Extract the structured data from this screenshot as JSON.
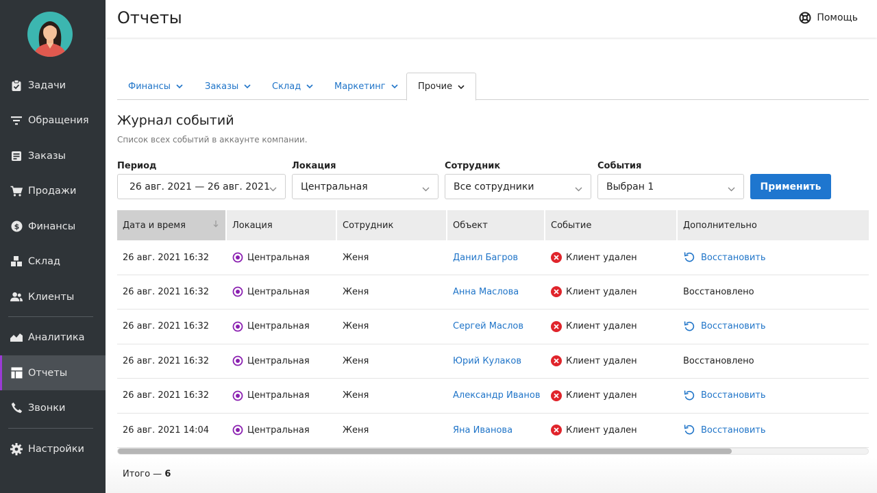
{
  "sidebar": {
    "items": [
      {
        "label": "Задачи",
        "icon": "clipboard-icon"
      },
      {
        "label": "Обращения",
        "icon": "filter-icon"
      },
      {
        "label": "Заказы",
        "icon": "order-icon"
      },
      {
        "label": "Продажи",
        "icon": "cart-icon"
      },
      {
        "label": "Финансы",
        "icon": "dollar-icon"
      },
      {
        "label": "Склад",
        "icon": "boxes-icon"
      },
      {
        "label": "Клиенты",
        "icon": "users-icon"
      },
      {
        "label": "Аналитика",
        "icon": "chart-icon"
      },
      {
        "label": "Отчеты",
        "icon": "table-icon"
      },
      {
        "label": "Звонки",
        "icon": "phone-icon"
      },
      {
        "label": "Настройки",
        "icon": "gear-icon"
      }
    ],
    "active": "Отчеты"
  },
  "header": {
    "title": "Отчеты",
    "help_label": "Помощь"
  },
  "tabs": [
    {
      "label": "Финансы"
    },
    {
      "label": "Заказы"
    },
    {
      "label": "Склад"
    },
    {
      "label": "Маркетинг"
    },
    {
      "label": "Прочие"
    }
  ],
  "section": {
    "title": "Журнал событий",
    "subtitle": "Список всех событий в аккаунте компании."
  },
  "filters": {
    "period": {
      "label": "Период",
      "value": "26 авг. 2021 — 26 авг. 2021"
    },
    "location": {
      "label": "Локация",
      "value": "Центральная"
    },
    "employee": {
      "label": "Сотрудник",
      "value": "Все сотрудники"
    },
    "events": {
      "label": "События",
      "value": "Выбран 1"
    },
    "apply_label": "Применить"
  },
  "table": {
    "columns": [
      "Дата и время",
      "Локация",
      "Сотрудник",
      "Объект",
      "Событие",
      "Дополнительно"
    ],
    "rows": [
      {
        "datetime": "26 авг. 2021 16:32",
        "location": "Центральная",
        "employee": "Женя",
        "object": "Данил Багров",
        "event": "Клиент удален",
        "extra": "Восстановить",
        "extra_is_action": true
      },
      {
        "datetime": "26 авг. 2021 16:32",
        "location": "Центральная",
        "employee": "Женя",
        "object": "Анна Маслова",
        "event": "Клиент удален",
        "extra": "Восстановлено",
        "extra_is_action": false
      },
      {
        "datetime": "26 авг. 2021 16:32",
        "location": "Центральная",
        "employee": "Женя",
        "object": "Сергей Маслов",
        "event": "Клиент удален",
        "extra": "Восстановить",
        "extra_is_action": true
      },
      {
        "datetime": "26 авг. 2021 16:32",
        "location": "Центральная",
        "employee": "Женя",
        "object": "Юрий Кулаков",
        "event": "Клиент удален",
        "extra": "Восстановлено",
        "extra_is_action": false
      },
      {
        "datetime": "26 авг. 2021 16:32",
        "location": "Центральная",
        "employee": "Женя",
        "object": "Александр Иванов",
        "event": "Клиент удален",
        "extra": "Восстановить",
        "extra_is_action": true
      },
      {
        "datetime": "26 авг. 2021 14:04",
        "location": "Центральная",
        "employee": "Женя",
        "object": "Яна Иванова",
        "event": "Клиент удален",
        "extra": "Восстановить",
        "extra_is_action": true
      }
    ]
  },
  "footer": {
    "total_label": "Итого —",
    "total_value": "6"
  },
  "colors": {
    "accent": "#1e76cf",
    "sidebar_bg": "#2f3438",
    "active_marker": "#9b3bd6",
    "location_icon": "#8a1fb0",
    "event_icon": "#e0242b"
  }
}
